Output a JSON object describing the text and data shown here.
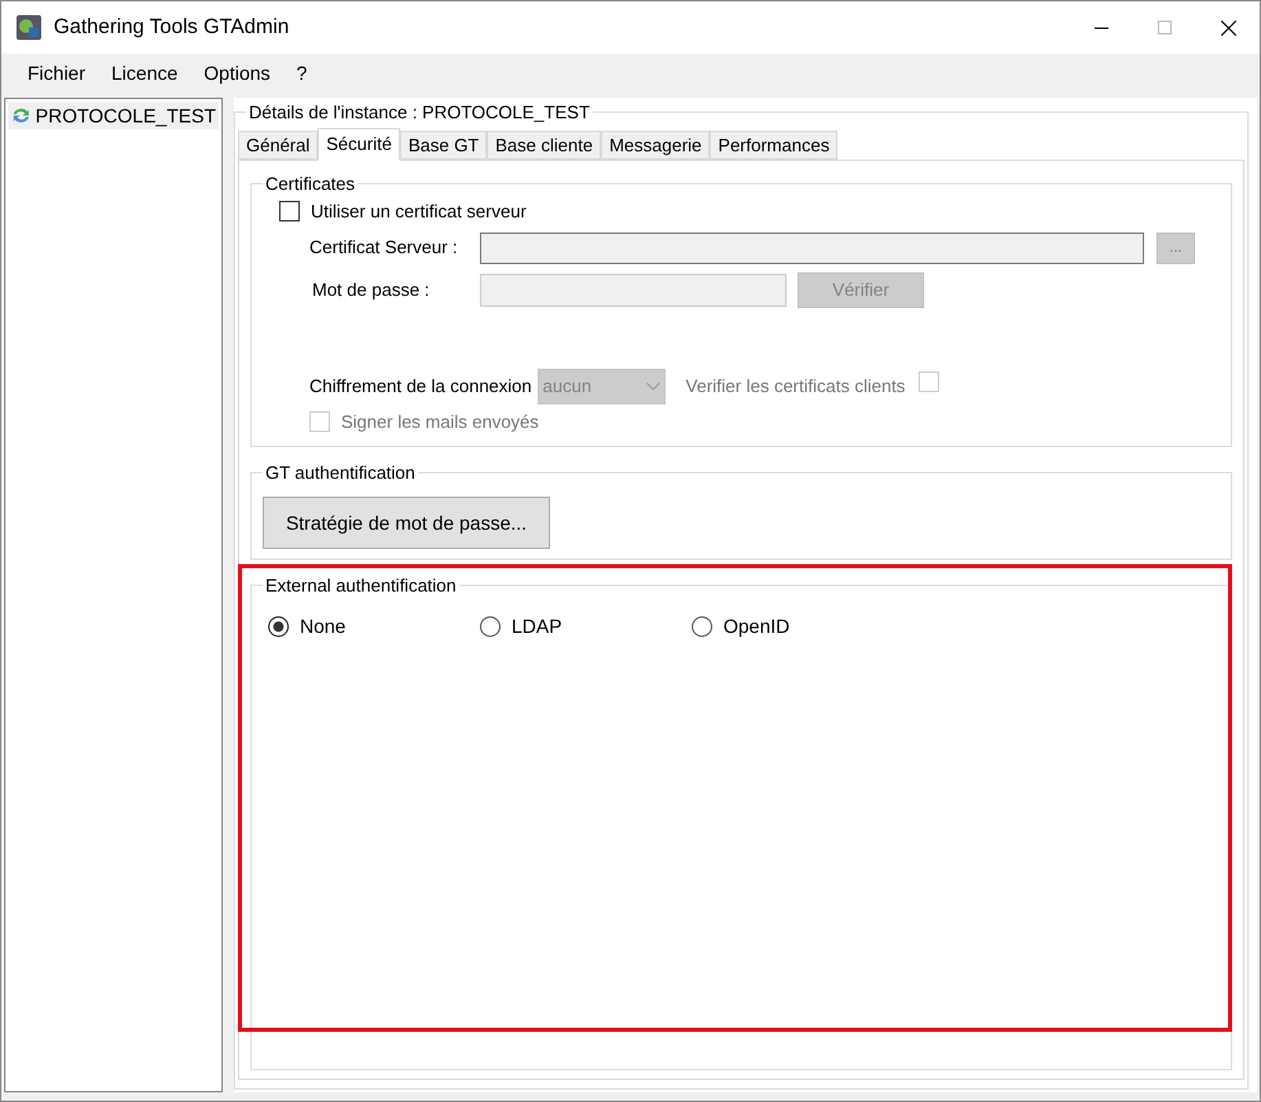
{
  "window": {
    "title": "Gathering Tools GTAdmin"
  },
  "menu": [
    "Fichier",
    "Licence",
    "Options",
    "?"
  ],
  "tree": {
    "items": [
      {
        "label": "PROTOCOLE_TEST",
        "selected": true
      }
    ]
  },
  "details": {
    "title": "Détails de l'instance : PROTOCOLE_TEST",
    "tabs": [
      {
        "label": "Général",
        "selected": false
      },
      {
        "label": "Sécurité",
        "selected": true
      },
      {
        "label": "Base GT",
        "selected": false
      },
      {
        "label": "Base cliente",
        "selected": false
      },
      {
        "label": "Messagerie",
        "selected": false
      },
      {
        "label": "Performances",
        "selected": false
      }
    ],
    "certificates": {
      "title": "Certificates",
      "use_server_cert": {
        "label": "Utiliser un certificat serveur",
        "checked": false
      },
      "server_cert_label": "Certificat Serveur :",
      "browse_button": "...",
      "password_label": "Mot de passe :",
      "verify_button": "Vérifier",
      "encryption_label": "Chiffrement de la connexion",
      "encryption_value": "aucun",
      "verify_clients": {
        "label": "Verifier les certificats clients",
        "checked": false
      },
      "sign_mails": {
        "label": "Signer les mails envoyés",
        "checked": false
      }
    },
    "gt_auth": {
      "title": "GT authentification",
      "button": "Stratégie de mot de passe..."
    },
    "external_auth": {
      "title": "External authentification",
      "options": [
        {
          "label": "None",
          "selected": true
        },
        {
          "label": "LDAP",
          "selected": false
        },
        {
          "label": "OpenID",
          "selected": false
        }
      ]
    }
  }
}
